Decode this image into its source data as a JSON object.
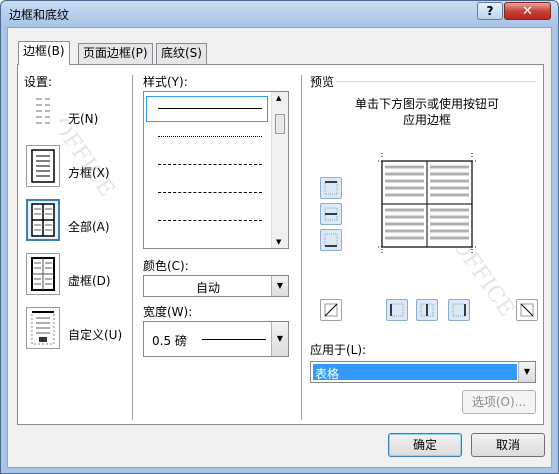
{
  "window": {
    "title": "边框和底纹",
    "help_label": "?",
    "close_label": "✕"
  },
  "tabs": [
    {
      "label": "边框(B)"
    },
    {
      "label": "页面边框(P)"
    },
    {
      "label": "底纹(S)"
    }
  ],
  "settings": {
    "heading": "设置:",
    "items": [
      {
        "label": "无(N)"
      },
      {
        "label": "方框(X)"
      },
      {
        "label": "全部(A)"
      },
      {
        "label": "虚框(D)"
      },
      {
        "label": "自定义(U)"
      }
    ]
  },
  "style": {
    "heading": "样式(Y):"
  },
  "color": {
    "heading": "颜色(C):",
    "value": "自动"
  },
  "width": {
    "heading": "宽度(W):",
    "value": "0.5 磅"
  },
  "preview": {
    "heading": "预览",
    "hint_line1": "单击下方图示或使用按钮可",
    "hint_line2": "应用边框"
  },
  "apply_to": {
    "heading": "应用于(L):",
    "value": "表格"
  },
  "buttons": {
    "options": "选项(O)...",
    "ok": "确定",
    "cancel": "取消"
  },
  "colors": {
    "selection": "#3399ff",
    "accent": "#3c7fb1"
  },
  "icons": [
    "border-none-icon",
    "border-box-icon",
    "border-all-icon",
    "border-grid-icon",
    "border-custom-icon"
  ]
}
